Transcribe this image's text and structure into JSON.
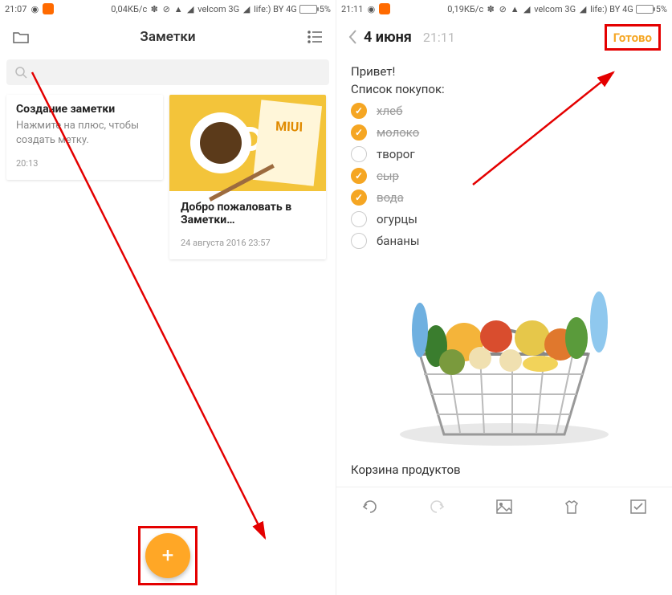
{
  "left": {
    "status": {
      "time": "21:07",
      "speed": "0,04КБ/с",
      "carrier1": "velcom 3G",
      "carrier2": "life:) BY 4G",
      "battery": "5%"
    },
    "title": "Заметки",
    "search_placeholder": "",
    "cards": [
      {
        "title": "Создание заметки",
        "subtitle": "Нажмите на плюс, чтобы создать метку.",
        "timestamp": "20:13"
      },
      {
        "title": "Добро пожаловать в Заметки…",
        "subtitle": "",
        "timestamp": "24 августа 2016 23:57"
      }
    ]
  },
  "right": {
    "status": {
      "time": "21:11",
      "speed": "0,19КБ/с",
      "carrier1": "velcom 3G",
      "carrier2": "life:) BY 4G",
      "battery": "5%"
    },
    "date": "4 июня",
    "time": "21:11",
    "done": "Готово",
    "greeting": "Привет!",
    "list_title": "Список покупок:",
    "items": [
      {
        "label": "хлеб",
        "checked": true
      },
      {
        "label": "молоко",
        "checked": true
      },
      {
        "label": "творог",
        "checked": false
      },
      {
        "label": "сыр",
        "checked": true
      },
      {
        "label": "вода",
        "checked": true
      },
      {
        "label": "огурцы",
        "checked": false
      },
      {
        "label": "бананы",
        "checked": false
      }
    ],
    "caption": "Корзина продуктов"
  }
}
